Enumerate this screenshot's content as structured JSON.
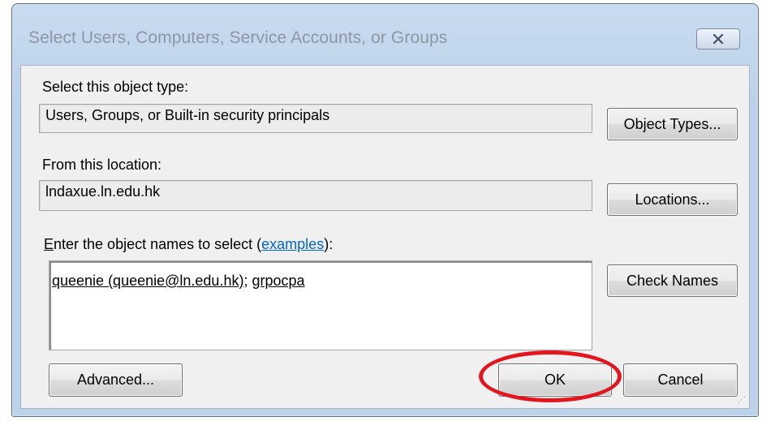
{
  "window": {
    "title": "Select Users, Computers, Service Accounts, or Groups"
  },
  "object_type": {
    "label": "Select this object type:",
    "value": "Users, Groups, or Built-in security principals",
    "button_label": "Object Types..."
  },
  "location": {
    "label": "From this location:",
    "value": "lndaxue.ln.edu.hk",
    "button_label": "Locations..."
  },
  "names": {
    "label_mnemonic": "E",
    "label_text": "nter the object names to select (",
    "label_link": "examples",
    "label_end": "):",
    "entries": [
      "queenie (queenie@ln.edu.hk)",
      "grpocpa"
    ],
    "separator": "; ",
    "check_button_label": "Check Names"
  },
  "footer": {
    "advanced_label": "Advanced...",
    "ok_label": "OK",
    "cancel_label": "Cancel"
  },
  "colors": {
    "highlight": "#e3161e",
    "link": "#0066cc"
  },
  "icons": {
    "close": "close-x-icon",
    "resize": "resize-grip-icon"
  }
}
